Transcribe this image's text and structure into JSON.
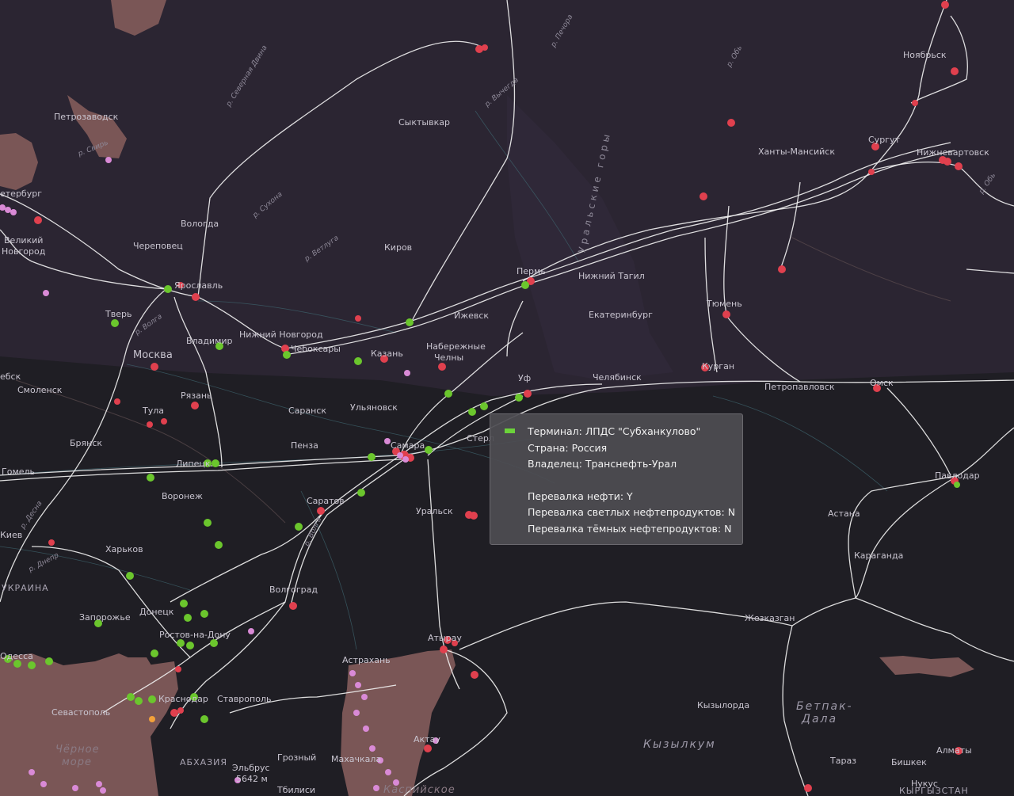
{
  "tooltip": {
    "terminal": "Терминал: ЛПДС \"Субханкулово\"",
    "country": "Страна: Россия",
    "owner": "Владелец: Транснефть-Урал",
    "oil": "Перевалка нефти: Y",
    "light": "Перевалка светлых нефтепродуктов: N",
    "dark": "Перевалка тёмных нефтепродуктов: N",
    "marker_color": "#6bd23a"
  },
  "cities": [
    {
      "name": "Ноябрьск"
    },
    {
      "name": "Сургут"
    },
    {
      "name": "Нижневартовск"
    },
    {
      "name": "Ханты-Мансийск"
    },
    {
      "name": "Сыктывкар"
    },
    {
      "name": "Петрозаводск"
    },
    {
      "name": "Санкт-Петербург",
      "text": "етербург"
    },
    {
      "name": "Вологда"
    },
    {
      "name": "Великий Новгород (line1)",
      "text": "Великий"
    },
    {
      "name": "Великий Новгород (line2)",
      "text": "Новгород"
    },
    {
      "name": "Череповец"
    },
    {
      "name": "Ярославль"
    },
    {
      "name": "Киров"
    },
    {
      "name": "Пермь"
    },
    {
      "name": "Нижний Тагил"
    },
    {
      "name": "Тверь"
    },
    {
      "name": "Нижний Новгород"
    },
    {
      "name": "Чебоксары"
    },
    {
      "name": "Ижевск"
    },
    {
      "name": "Екатеринбург"
    },
    {
      "name": "Тюмень"
    },
    {
      "name": "Владимир"
    },
    {
      "name": "Москва"
    },
    {
      "name": "Казань"
    },
    {
      "name": "Набережные (line1)",
      "text": "Набережные"
    },
    {
      "name": "Набережные (line2)",
      "text": "Челны"
    },
    {
      "name": "Челябинск"
    },
    {
      "name": "Курган"
    },
    {
      "name": "Витебск",
      "text": "ебск"
    },
    {
      "name": "Смоленск"
    },
    {
      "name": "Рязань"
    },
    {
      "name": "Петропавловск"
    },
    {
      "name": "Омск"
    },
    {
      "name": "Тула"
    },
    {
      "name": "Саранск"
    },
    {
      "name": "Ульяновск"
    },
    {
      "name": "Стерлитамак",
      "text": "Стерл"
    },
    {
      "name": "Брянск"
    },
    {
      "name": "Пенза"
    },
    {
      "name": "Самара"
    },
    {
      "name": "Гомель"
    },
    {
      "name": "Липецк"
    },
    {
      "name": "Павлодар"
    },
    {
      "name": "Воронеж"
    },
    {
      "name": "Саратов"
    },
    {
      "name": "Уральск"
    },
    {
      "name": "Астана"
    },
    {
      "name": "Киев",
      "text": "Киев"
    },
    {
      "name": "Харьков"
    },
    {
      "name": "Караганда"
    },
    {
      "name": "Волгоград"
    },
    {
      "name": "Донецк"
    },
    {
      "name": "Запорожье"
    },
    {
      "name": "Жезказган"
    },
    {
      "name": "Ростов-на-Дону"
    },
    {
      "name": "Атырау"
    },
    {
      "name": "Одесса",
      "text": "Одесса"
    },
    {
      "name": "Астрахань"
    },
    {
      "name": "Краснодар"
    },
    {
      "name": "Ставрополь"
    },
    {
      "name": "Кызылорда"
    },
    {
      "name": "Севастополь"
    },
    {
      "name": "Актау"
    },
    {
      "name": "Грозный"
    },
    {
      "name": "Махачкала"
    },
    {
      "name": "Эльбрус"
    },
    {
      "name": "5642 м"
    },
    {
      "name": "Тбилиси"
    },
    {
      "name": "Тараз"
    },
    {
      "name": "Бишкек"
    },
    {
      "name": "Алматы"
    },
    {
      "name": "Нукус"
    },
    {
      "name": "Уфа",
      "text": "Уф"
    }
  ],
  "regions": [
    {
      "name": "Украина",
      "text": "УКРАИНА"
    },
    {
      "name": "Абхазия",
      "text": "АБХАЗИЯ"
    },
    {
      "name": "Кыргызстан",
      "text": "КЫРГЫЗСТАН"
    }
  ],
  "water_labels": [
    {
      "text": "Чёрное"
    },
    {
      "text": "море"
    },
    {
      "text": "Каспийское"
    }
  ],
  "desert_labels": [
    {
      "text": "Кызылкум"
    },
    {
      "text": "Бетпак-"
    },
    {
      "text": "Дала"
    }
  ],
  "river_labels": [
    {
      "text": "р. Северная Двина"
    },
    {
      "text": "р. Вычегда"
    },
    {
      "text": "р. Печора"
    },
    {
      "text": "р. Обь"
    },
    {
      "text": "р. Сухона"
    },
    {
      "text": "р. Свирь"
    },
    {
      "text": "р. Ветлуга"
    },
    {
      "text": "р. Волга"
    },
    {
      "text": "р. Десна"
    },
    {
      "text": "р. Днепр"
    },
    {
      "text": "р. Волга"
    },
    {
      "text": "р. Обь"
    }
  ],
  "range_label": {
    "text": "Уральские горы"
  },
  "marker_colors": {
    "red": "#e0404e",
    "green": "#6bc62d",
    "pink": "#d98ad6",
    "orange": "#f2a13a"
  }
}
